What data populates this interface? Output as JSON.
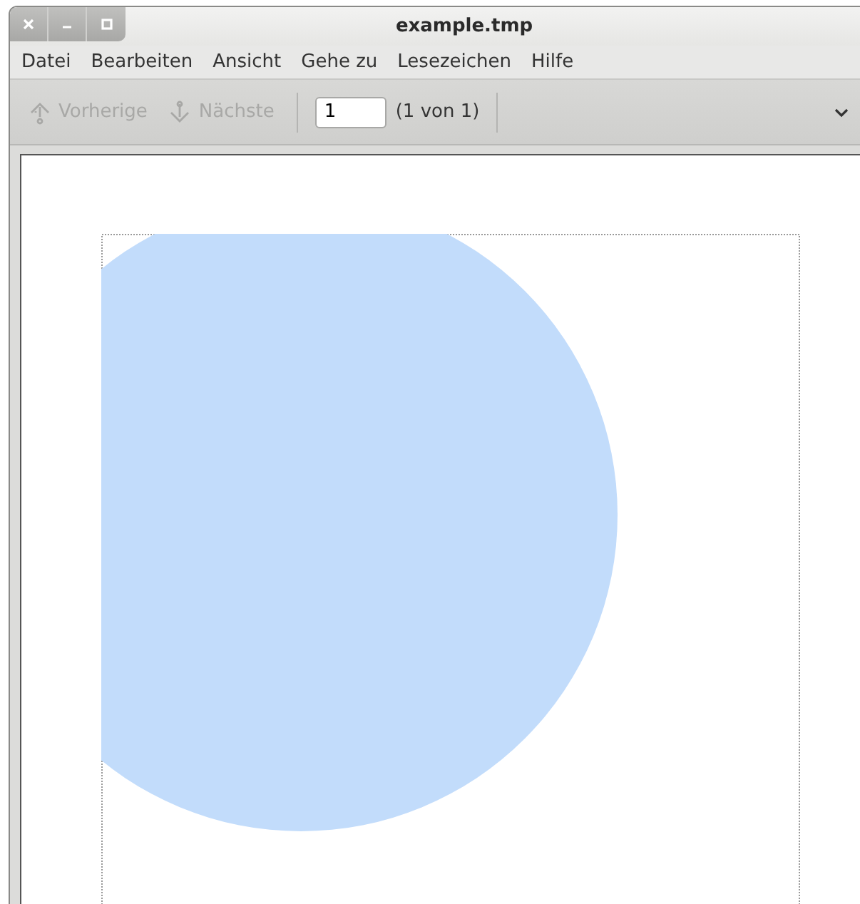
{
  "window": {
    "title": "example.tmp"
  },
  "menu": [
    "Datei",
    "Bearbeiten",
    "Ansicht",
    "Gehe zu",
    "Lesezeichen",
    "Hilfe"
  ],
  "toolbar": {
    "buttons": [
      {
        "label": "Vorherige",
        "kind": "up",
        "disabled": true
      },
      {
        "label": "Nächste",
        "kind": "down",
        "disabled": true
      }
    ],
    "page_field": {
      "value": "1"
    },
    "page_count": "(1 von 1)"
  }
}
